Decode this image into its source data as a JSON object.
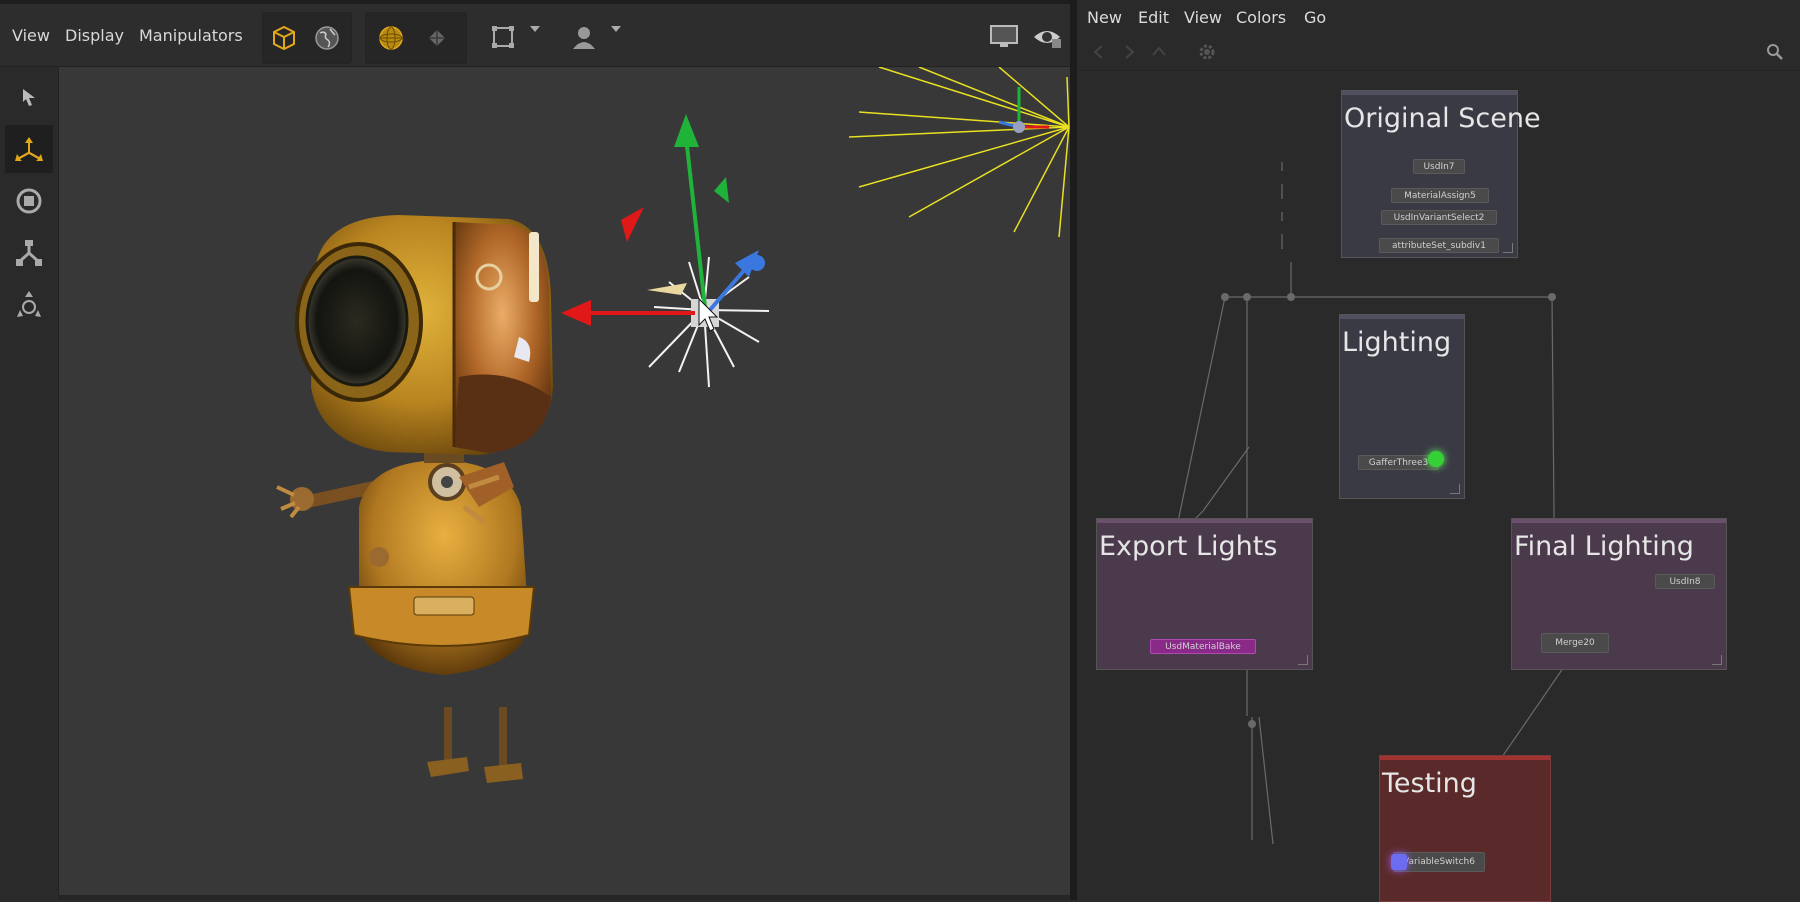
{
  "viewer": {
    "menu": [
      "View",
      "Display",
      "Manipulators"
    ]
  },
  "nodegraph": {
    "menu": [
      "New",
      "Edit",
      "View",
      "Colors",
      "Go"
    ],
    "backdrops": {
      "original_scene": {
        "title": "Original Scene",
        "color": "#3a3a44"
      },
      "lighting": {
        "title": "Lighting",
        "color": "#3a3a44"
      },
      "export_lights": {
        "title": "Export Lights",
        "color": "#4a3a4c"
      },
      "final_lighting": {
        "title": "Final Lighting",
        "color": "#4a3a4c"
      },
      "testing": {
        "title": "Testing",
        "color": "#5a2a2a"
      }
    },
    "nodes": {
      "usdin7": "UsdIn7",
      "material_assign5": "MaterialAssign5",
      "usdin_variant_select2": "UsdInVariantSelect2",
      "attributeset_subdiv1": "attributeSet_subdiv1",
      "gaffer_three3": "GafferThree3",
      "usd_material_bake": "UsdMaterialBake",
      "usdin8": "UsdIn8",
      "merge20": "Merge20",
      "variable_switch6": "VariableSwitch6"
    }
  },
  "colors": {
    "gizmo_x": "#e01818",
    "gizmo_y": "#1fb33a",
    "gizmo_z": "#3a78e0",
    "light_rays": "#e8e020",
    "accent_icon": "#e3a81a",
    "usd_bake_node": "#8a2a88"
  }
}
